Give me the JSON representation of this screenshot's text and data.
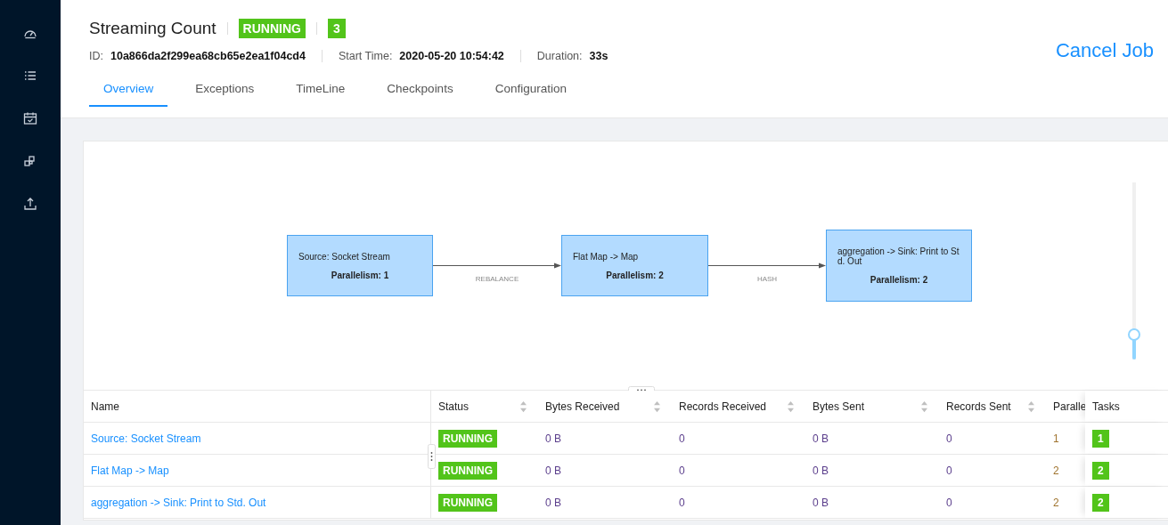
{
  "job": {
    "title": "Streaming Count",
    "status": "RUNNING",
    "task_count": "3",
    "id_label": "ID:",
    "id": "10a866da2f299ea68cb65e2ea1f04cd4",
    "start_label": "Start Time:",
    "start": "2020-05-20 10:54:42",
    "duration_label": "Duration:",
    "duration": "33s",
    "cancel": "Cancel Job"
  },
  "tabs": [
    {
      "label": "Overview",
      "selected": true
    },
    {
      "label": "Exceptions",
      "selected": false
    },
    {
      "label": "TimeLine",
      "selected": false
    },
    {
      "label": "Checkpoints",
      "selected": false
    },
    {
      "label": "Configuration",
      "selected": false
    }
  ],
  "graph": {
    "nodes": [
      {
        "name": "Source: Socket Stream",
        "parallelism": "Parallelism: 1"
      },
      {
        "name": "Flat Map -> Map",
        "parallelism": "Parallelism: 2"
      },
      {
        "name": "aggregation -> Sink: Print to Std. Out",
        "parallelism": "Parallelism: 2"
      }
    ],
    "edges": [
      {
        "label": "REBALANCE"
      },
      {
        "label": "HASH"
      }
    ],
    "zoom": {
      "level": 0.14
    }
  },
  "table": {
    "columns": [
      {
        "label": "Name",
        "sortable": false
      },
      {
        "label": "Status",
        "sortable": true
      },
      {
        "label": "Bytes Received",
        "sortable": true
      },
      {
        "label": "Records Received",
        "sortable": true
      },
      {
        "label": "Bytes Sent",
        "sortable": true
      },
      {
        "label": "Records Sent",
        "sortable": true
      },
      {
        "label": "Paralle"
      },
      {
        "label": "Tasks",
        "sortable": false
      }
    ],
    "rows": [
      {
        "name": "Source: Socket Stream",
        "status": "RUNNING",
        "bytes_received": "0 B",
        "records_received": "0",
        "bytes_sent": "0 B",
        "records_sent": "0",
        "parallelism": "1",
        "tasks": "1"
      },
      {
        "name": "Flat Map -> Map",
        "status": "RUNNING",
        "bytes_received": "0 B",
        "records_received": "0",
        "bytes_sent": "0 B",
        "records_sent": "0",
        "parallelism": "2",
        "tasks": "2"
      },
      {
        "name": "aggregation -> Sink: Print to Std. Out",
        "status": "RUNNING",
        "bytes_received": "0 B",
        "records_received": "0",
        "bytes_sent": "0 B",
        "records_sent": "0",
        "parallelism": "2",
        "tasks": "2"
      }
    ]
  }
}
